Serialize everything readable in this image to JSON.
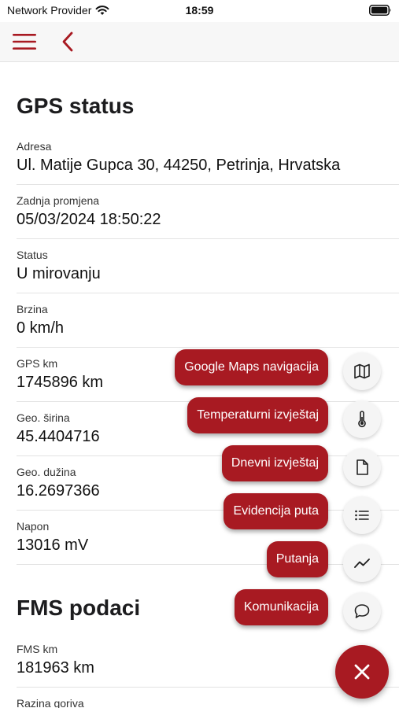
{
  "status_bar": {
    "carrier": "Network Provider",
    "time": "18:59"
  },
  "sections": {
    "gps_title": "GPS status",
    "fms_title": "FMS podaci"
  },
  "gps_fields": [
    {
      "label": "Adresa",
      "value": "Ul. Matije Gupca 30, 44250, Petrinja, Hrvatska"
    },
    {
      "label": "Zadnja promjena",
      "value": "05/03/2024 18:50:22"
    },
    {
      "label": "Status",
      "value": "U mirovanju"
    },
    {
      "label": "Brzina",
      "value": "0 km/h"
    },
    {
      "label": "GPS km",
      "value": "1745896 km"
    },
    {
      "label": "Geo. širina",
      "value": "45.4404716"
    },
    {
      "label": "Geo. dužina",
      "value": "16.2697366"
    },
    {
      "label": "Napon",
      "value": "13016 mV"
    }
  ],
  "fms_fields": [
    {
      "label": "FMS km",
      "value": "181963 km"
    },
    {
      "label": "Razina goriva",
      "value": ""
    }
  ],
  "fab_menu": [
    {
      "label": "Google Maps navigacija",
      "icon": "map-icon"
    },
    {
      "label": "Temperaturni izvještaj",
      "icon": "thermometer-icon"
    },
    {
      "label": "Dnevni izvještaj",
      "icon": "document-icon"
    },
    {
      "label": "Evidencija puta",
      "icon": "list-icon"
    },
    {
      "label": "Putanja",
      "icon": "trend-line-icon"
    },
    {
      "label": "Komunikacija",
      "icon": "chat-bubble-icon"
    }
  ],
  "colors": {
    "accent": "#a81a22",
    "text": "#1c1c1e",
    "divider": "#e3e3e3"
  }
}
